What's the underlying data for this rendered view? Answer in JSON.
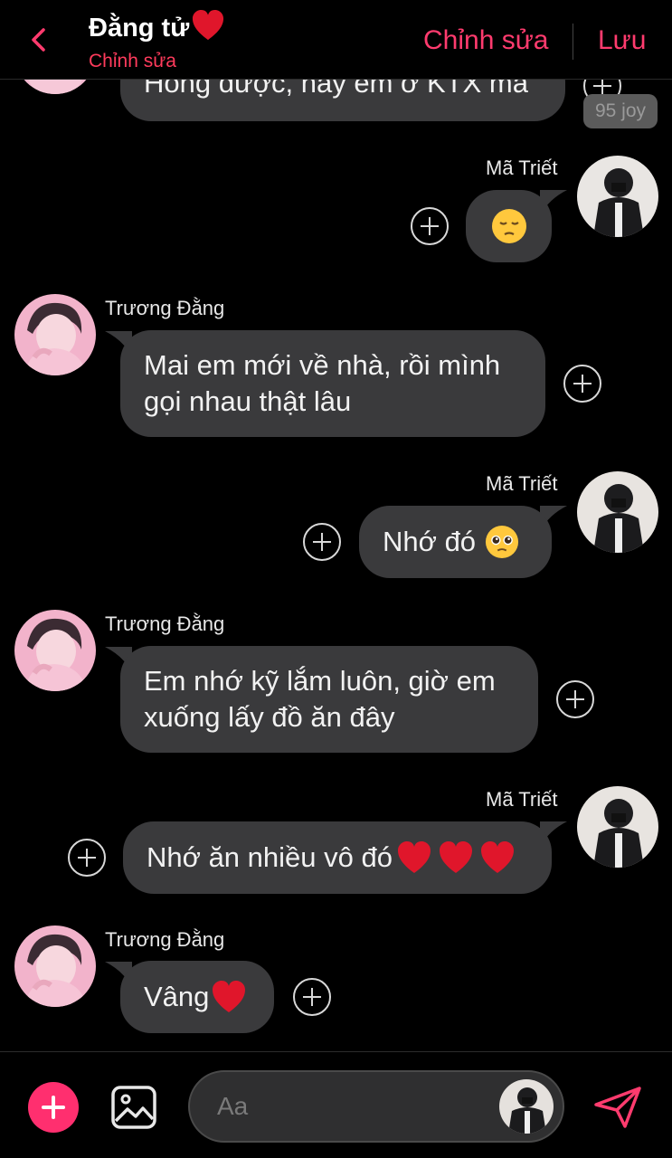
{
  "header": {
    "title": "Đằng tử",
    "subtitle": "Chỉnh sửa",
    "edit_label": "Chỉnh sửa",
    "save_label": "Lưu"
  },
  "reaction_badge": "95 joy",
  "messages": [
    {
      "sender": "Trương Đằng",
      "side": "left",
      "text": "Hong được, nay em ở KTX mà"
    },
    {
      "sender": "Mã Triết",
      "side": "right",
      "text": "",
      "emoji": "pensive-face"
    },
    {
      "sender": "Trương Đằng",
      "side": "left",
      "lines": [
        "Mai em mới về nhà, rồi mình",
        "gọi nhau thật lâu"
      ]
    },
    {
      "sender": "Mã Triết",
      "side": "right",
      "text": "Nhớ đó",
      "emoji": "pleading-face"
    },
    {
      "sender": "Trương Đằng",
      "side": "left",
      "lines": [
        "Em nhớ kỹ lắm luôn, giờ em",
        "xuống lấy đồ ăn đây"
      ]
    },
    {
      "sender": "Mã Triết",
      "side": "right",
      "text": "Nhớ ăn nhiều vô đó",
      "emoji": "red-heart x3"
    },
    {
      "sender": "Trương Đằng",
      "side": "left",
      "text": "Vâng",
      "emoji": "red-heart"
    }
  ],
  "composer": {
    "placeholder": "Aa"
  },
  "colors": {
    "accent": "#ff3b6e",
    "bubble": "#3a3a3c",
    "background": "#000000"
  }
}
